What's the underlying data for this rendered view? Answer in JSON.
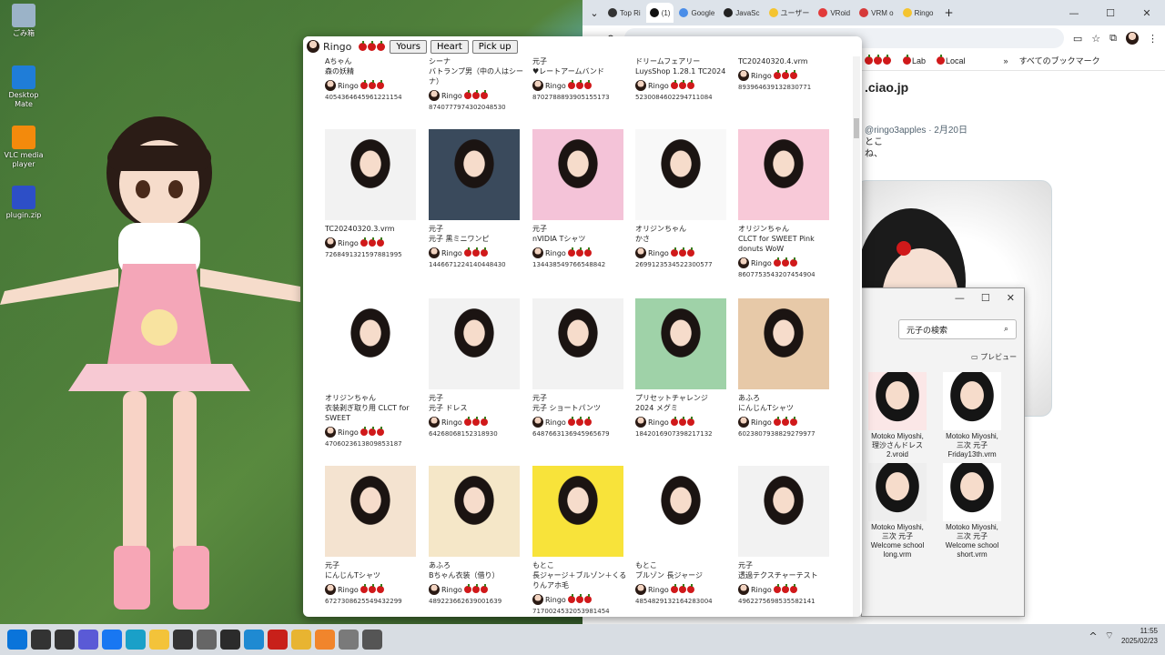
{
  "desktop": {
    "icons": [
      {
        "label": "ごみ箱",
        "icon": "recycle-bin-icon",
        "color": "#9bb3c8"
      },
      {
        "label": "Desktop Mate",
        "icon": "desktop-mate-icon",
        "color": "#1f7dd8"
      },
      {
        "label": "VLC media player",
        "icon": "vlc-icon",
        "color": "#f38a0c"
      },
      {
        "label": "plugin.zip",
        "icon": "zip-file-icon",
        "color": "#2d4fc7"
      }
    ]
  },
  "chrome": {
    "tabs": [
      {
        "label": "Top Ri",
        "color": "#333333"
      },
      {
        "label": "(1)",
        "color": "#111111",
        "active": true
      },
      {
        "label": "Google",
        "color": "#4a8de8"
      },
      {
        "label": "JavaSc",
        "color": "#222222"
      },
      {
        "label": "ユーザー",
        "color": "#f4c430"
      },
      {
        "label": "VRoid",
        "color": "#e23a3a"
      },
      {
        "label": "VRM o",
        "color": "#d63a3a"
      },
      {
        "label": "Ringo",
        "color": "#f4c430"
      }
    ],
    "bookmarks": [
      "Lab",
      "Local",
      "すべてのブックマーク"
    ],
    "page_title": ".ciao.jp",
    "post_meta": "@ringo3apples · 2月20日",
    "post_text": [
      "とこ",
      "ね、"
    ]
  },
  "explorer": {
    "search_placeholder": "元子の検索",
    "preview_label": "プレビュー",
    "files": [
      {
        "name": "Motoko Miyoshi, 理沙さんドレス 2.vroid"
      },
      {
        "name": "Motoko Miyoshi, 三次 元子 Friday13th.vrm"
      },
      {
        "name": "Motoko Miyoshi, 三次 元子 Welcome school long.vrm"
      },
      {
        "name": "Motoko Miyoshi, 三次 元子 Welcome school short.vrm"
      }
    ]
  },
  "viewer": {
    "user_name": "Ringo",
    "buttons": {
      "yours": "Yours",
      "heart": "Heart",
      "pickup": "Pick up"
    },
    "cards": [
      {
        "author": "Aちゃん",
        "title": "森の妖精",
        "owner": "Ringo",
        "id": "4054364645961221154",
        "color": "#ffffff"
      },
      {
        "author": "シーナ",
        "title": "バトランプ男（中の人はシーナ）",
        "owner": "Ringo",
        "id": "8740777974302048530",
        "color": "#ffffff"
      },
      {
        "author": "元子",
        "title": "♥レートアームバンド",
        "owner": "Ringo",
        "id": "8702788893905155173",
        "color": "#ffffff"
      },
      {
        "author": "ドリームフェアリー",
        "title": "LuysShop 1.28.1 TC2024",
        "owner": "Ringo",
        "id": "5230084602294711084",
        "color": "#ffffff"
      },
      {
        "author": "",
        "title": "TC20240320.4.vrm",
        "owner": "Ringo",
        "id": "8939646391328307​71",
        "color": "#ffffff"
      },
      {
        "author": "",
        "title": "TC20240320.3.vrm",
        "owner": "Ringo",
        "id": "7268491321597881995",
        "color": "#f2f2f2"
      },
      {
        "author": "元子",
        "title": "元子 黒ミニワンピ",
        "owner": "Ringo",
        "id": "1446671224140448430",
        "color": "#3a4a5c"
      },
      {
        "author": "元子",
        "title": "nVIDIA Tシャツ",
        "owner": "Ringo",
        "id": "1344385497665488​42",
        "color": "#f4c3d8"
      },
      {
        "author": "オリジンちゃん",
        "title": "かさ",
        "owner": "Ringo",
        "id": "2699123534522300577",
        "color": "#f8f8f8"
      },
      {
        "author": "オリジンちゃん",
        "title": "CLCT for SWEET Pink donuts WoW",
        "owner": "Ringo",
        "id": "8607753543207454904",
        "color": "#f8c9d8"
      },
      {
        "author": "オリジンちゃん",
        "title": "衣装剥ぎ取り用 CLCT for SWEET",
        "owner": "Ringo",
        "id": "4706023613809853187",
        "color": "#ffffff"
      },
      {
        "author": "元子",
        "title": "元子 ドレス",
        "owner": "Ringo",
        "id": "6426806815231893​0",
        "color": "#f2f2f2"
      },
      {
        "author": "元子",
        "title": "元子 ショートパンツ",
        "owner": "Ringo",
        "id": "6487663136945965679",
        "color": "#f2f2f2"
      },
      {
        "author": "プリセットチャレンジ",
        "title": "2024 メグミ",
        "owner": "Ringo",
        "id": "1842016907398217132",
        "color": "#9fd2a8"
      },
      {
        "author": "あふろ",
        "title": "にんじんTシャツ",
        "owner": "Ringo",
        "id": "6023807938829279977",
        "color": "#e7c9a8"
      },
      {
        "author": "元子",
        "title": "にんじんTシャツ",
        "owner": "Ringo",
        "id": "6727308625549432299",
        "color": "#f4e3d0"
      },
      {
        "author": "あふろ",
        "title": "Bちゃん衣装（借り）",
        "owner": "Ringo",
        "id": "4892236626390016​39",
        "color": "#f5e7c8"
      },
      {
        "author": "もとこ",
        "title": "長ジャージ＋ブルゾン＋くるりんアホ毛",
        "owner": "Ringo",
        "id": "7170024532053981454",
        "color": "#f8e33a"
      },
      {
        "author": "もとこ",
        "title": "ブルゾン 長ジャージ",
        "owner": "Ringo",
        "id": "4854829132164283004",
        "color": "#ffffff"
      },
      {
        "author": "元子",
        "title": "透過テクスチャーテスト",
        "owner": "Ringo",
        "id": "4962275698535582141",
        "color": "#f2f2f2"
      }
    ]
  },
  "taskbar": {
    "time": "11:55",
    "date": "2025/02/23",
    "icons": [
      {
        "name": "windows-start-icon",
        "color": "#0a74da"
      },
      {
        "name": "search-icon",
        "color": "#333333"
      },
      {
        "name": "task-view-icon",
        "color": "#333333"
      },
      {
        "name": "copilot-icon",
        "color": "#5a5ad6"
      },
      {
        "name": "meta-icon",
        "color": "#1877f2"
      },
      {
        "name": "edge-icon",
        "color": "#1aa0c8"
      },
      {
        "name": "file-explorer-icon",
        "color": "#f3c33a"
      },
      {
        "name": "clapper-icon",
        "color": "#333333"
      },
      {
        "name": "settings-icon",
        "color": "#666666"
      },
      {
        "name": "terminal-icon",
        "color": "#2b2b2b"
      },
      {
        "name": "vscode-icon",
        "color": "#1f8ad2"
      },
      {
        "name": "flash-icon",
        "color": "#c8201a"
      },
      {
        "name": "chrome-icon",
        "color": "#e8b431"
      },
      {
        "name": "xampp-icon",
        "color": "#f1852c"
      },
      {
        "name": "app-icon",
        "color": "#7a7a7a"
      },
      {
        "name": "app-icon",
        "color": "#555555"
      }
    ]
  }
}
